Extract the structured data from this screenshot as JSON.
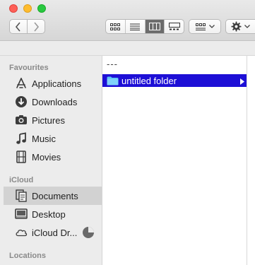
{
  "toolbar": {
    "back_icon": "chevron-left-icon",
    "forward_icon": "chevron-right-icon",
    "views": [
      "icon-view",
      "list-view",
      "column-view",
      "gallery-view"
    ],
    "active_view": "column-view",
    "group_icon": "group-icon",
    "action_icon": "gear-icon"
  },
  "sidebar": {
    "sections": [
      {
        "title": "Favourites",
        "items": [
          {
            "label": "Applications",
            "icon": "applications-icon"
          },
          {
            "label": "Downloads",
            "icon": "downloads-icon"
          },
          {
            "label": "Pictures",
            "icon": "pictures-icon"
          },
          {
            "label": "Music",
            "icon": "music-icon"
          },
          {
            "label": "Movies",
            "icon": "movies-icon"
          }
        ]
      },
      {
        "title": "iCloud",
        "items": [
          {
            "label": "Documents",
            "icon": "documents-icon",
            "selected": true
          },
          {
            "label": "Desktop",
            "icon": "desktop-icon"
          },
          {
            "label": "iCloud Dr...",
            "icon": "cloud-icon"
          }
        ]
      },
      {
        "title": "Locations",
        "items": []
      }
    ]
  },
  "column": {
    "header": "---",
    "items": [
      {
        "label": "untitled folder",
        "icon": "folder-icon",
        "selected": true
      }
    ]
  },
  "colors": {
    "selection": "#1d0fd6",
    "folder": "#5ac3f5",
    "sidebar_bg": "#ececec",
    "sidebar_selected": "#d2d2d2"
  }
}
